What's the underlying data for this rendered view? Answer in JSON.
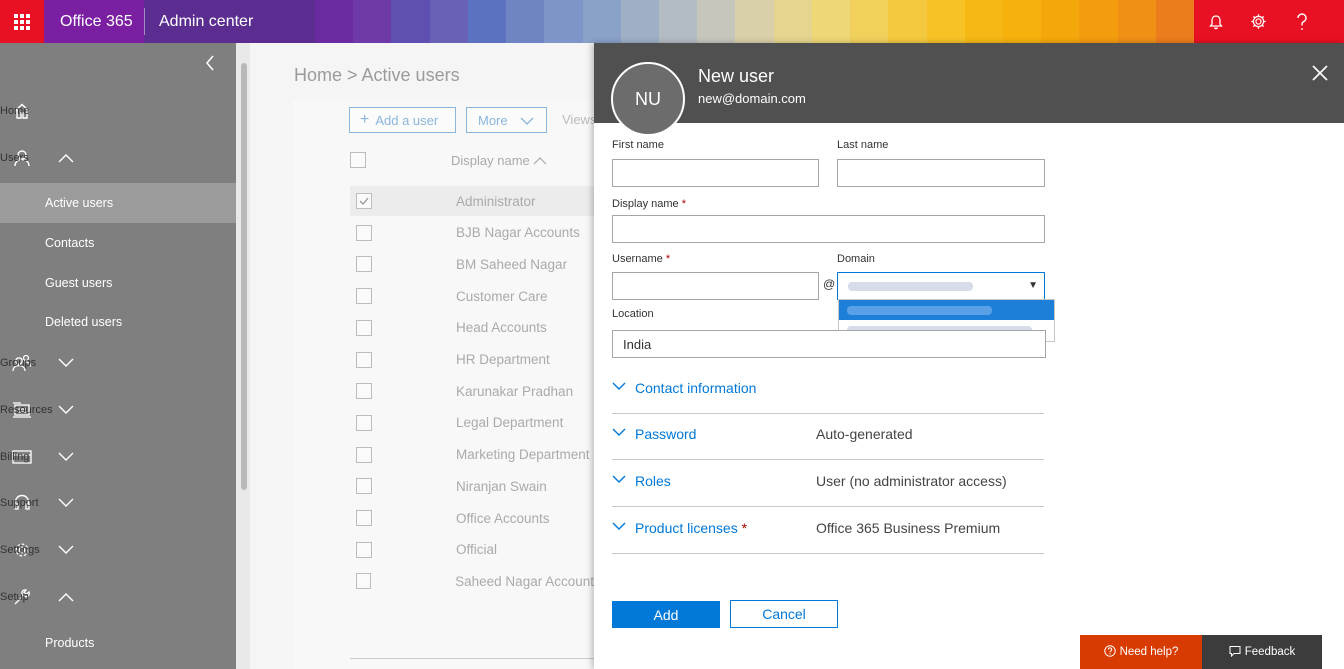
{
  "topbar": {
    "brand": "Office 365",
    "app_title": "Admin center",
    "icons": [
      "bell-icon",
      "gear-icon",
      "help-icon"
    ],
    "mosaic_colors": [
      "#6a2aa0",
      "#6f3aa8",
      "#5e4fb0",
      "#6961b6",
      "#5a72bf",
      "#6f84c3",
      "#7e95c8",
      "#8aa2c8",
      "#9fb0c6",
      "#b3bcc3",
      "#c7c6bd",
      "#d9cfa9",
      "#e5d58f",
      "#eed777",
      "#f1d05c",
      "#f4c93f",
      "#f6c226",
      "#f5b814",
      "#f6b10c",
      "#f4a70a",
      "#f39c0e",
      "#f09015",
      "#ec7d1d"
    ]
  },
  "nav": {
    "home": "Home",
    "users": "Users",
    "active_users": "Active users",
    "contacts": "Contacts",
    "guest_users": "Guest users",
    "deleted_users": "Deleted users",
    "groups": "Groups",
    "resources": "Resources",
    "billing": "Billing",
    "support": "Support",
    "settings": "Settings",
    "setup": "Setup",
    "products": "Products"
  },
  "main": {
    "breadcrumb": "Home > Active users",
    "add_user": "Add a user",
    "more": "More",
    "views": "Views",
    "col_display_name": "Display name",
    "rows": [
      "Administrator",
      "BJB Nagar Accounts",
      "BM Saheed Nagar",
      "Customer Care",
      "Head Accounts",
      "HR Department",
      "Karunakar Pradhan",
      "Legal Department",
      "Marketing Department",
      "Niranjan Swain",
      "Office Accounts",
      "Official",
      "Saheed Nagar Account"
    ]
  },
  "panel": {
    "avatar_initials": "NU",
    "title": "New user",
    "subtitle": "new@domain.com",
    "first_name_label": "First name",
    "last_name_label": "Last name",
    "display_name_label": "Display name",
    "username_label": "Username",
    "domain_label": "Domain",
    "at_sign": "@",
    "location_label": "Location",
    "location_value": "India",
    "required_mark": "*",
    "contact_info": "Contact information",
    "password": "Password",
    "password_value": "Auto-generated",
    "roles": "Roles",
    "roles_value": "User (no administrator access)",
    "product_licenses": "Product licenses",
    "product_licenses_value": "Office 365 Business Premium",
    "add_button": "Add",
    "cancel_button": "Cancel"
  },
  "footer": {
    "need_help": "Need help?",
    "feedback": "Feedback"
  },
  "colors": {
    "accent": "#0078d7",
    "brand_red": "#e81123",
    "need_help_bg": "#d83b01"
  }
}
